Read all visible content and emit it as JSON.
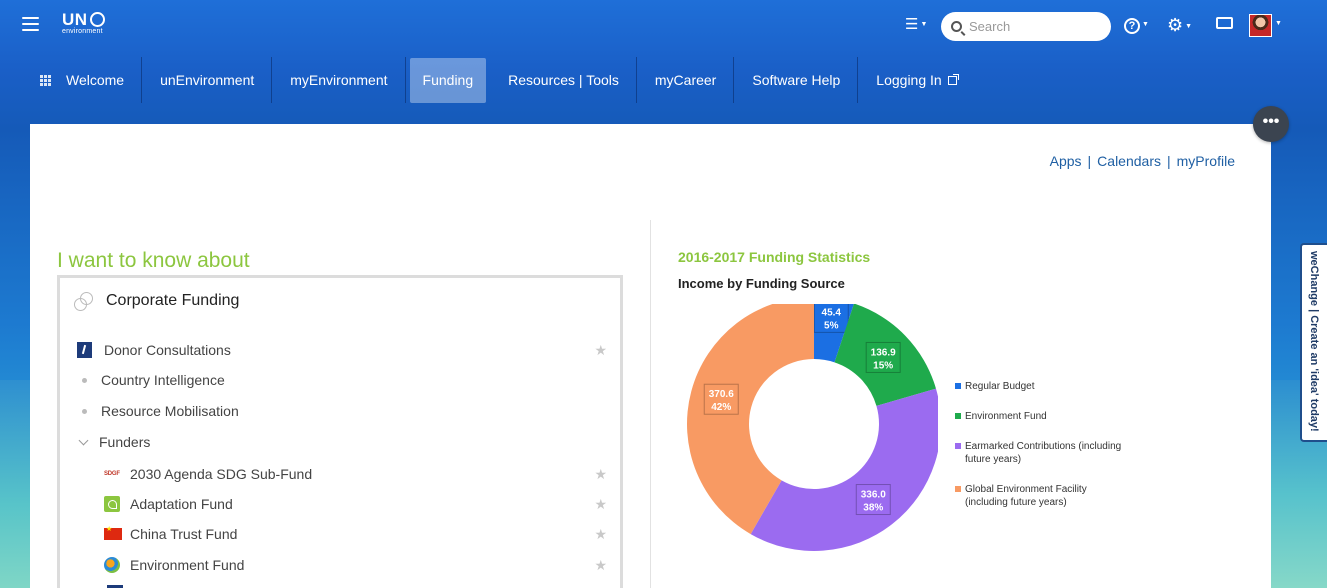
{
  "header": {
    "logo_main": "UN",
    "logo_sub": "environment",
    "search_placeholder": "Search",
    "icons": [
      "menu-icon",
      "list-icon",
      "search-icon",
      "help-icon",
      "gear-icon",
      "inbox-icon",
      "avatar"
    ]
  },
  "nav": {
    "items": [
      {
        "label": "Welcome",
        "active": false
      },
      {
        "label": "unEnvironment",
        "active": false
      },
      {
        "label": "myEnvironment",
        "active": false
      },
      {
        "label": "Funding",
        "active": true
      },
      {
        "label": "Resources | Tools",
        "active": false
      },
      {
        "label": "myCareer",
        "active": false
      },
      {
        "label": "Software Help",
        "active": false
      },
      {
        "label": "Logging In",
        "active": false
      }
    ]
  },
  "toplinks": {
    "apps": "Apps",
    "calendars": "Calendars",
    "profile": "myProfile",
    "sep": "|"
  },
  "left": {
    "heading": "I want to know about",
    "section": "Corporate Funding",
    "items": [
      {
        "label": "Donor Consultations"
      },
      {
        "label": "Country Intelligence"
      },
      {
        "label": "Resource Mobilisation"
      },
      {
        "label": "Funders"
      }
    ],
    "funders": [
      {
        "label": "2030 Agenda SDG Sub-Fund",
        "icon_text": "SDGF"
      },
      {
        "label": "Adaptation Fund"
      },
      {
        "label": "China Trust Fund"
      },
      {
        "label": "Environment Fund"
      }
    ]
  },
  "chart_data": {
    "type": "pie",
    "title": "2016-2017 Funding Statistics",
    "subtitle": "Income by Funding Source",
    "legend_position": "right",
    "series": [
      {
        "name": "Regular Budget",
        "value": 45.4,
        "percent": "5%",
        "color": "#1b6fe3"
      },
      {
        "name": "Environment Fund",
        "value": 136.9,
        "percent": "15%",
        "color": "#1faa4c"
      },
      {
        "name": "Earmarked Contributions (including future years)",
        "value": 336.0,
        "percent": "38%",
        "color": "#9b6bf0"
      },
      {
        "name": "Global Environment Facility (including future years)",
        "value": 370.6,
        "percent": "42%",
        "color": "#f89a63"
      }
    ]
  },
  "wechange": {
    "label": "weChange | Create an 'idea' today!"
  },
  "more_button": "•••"
}
